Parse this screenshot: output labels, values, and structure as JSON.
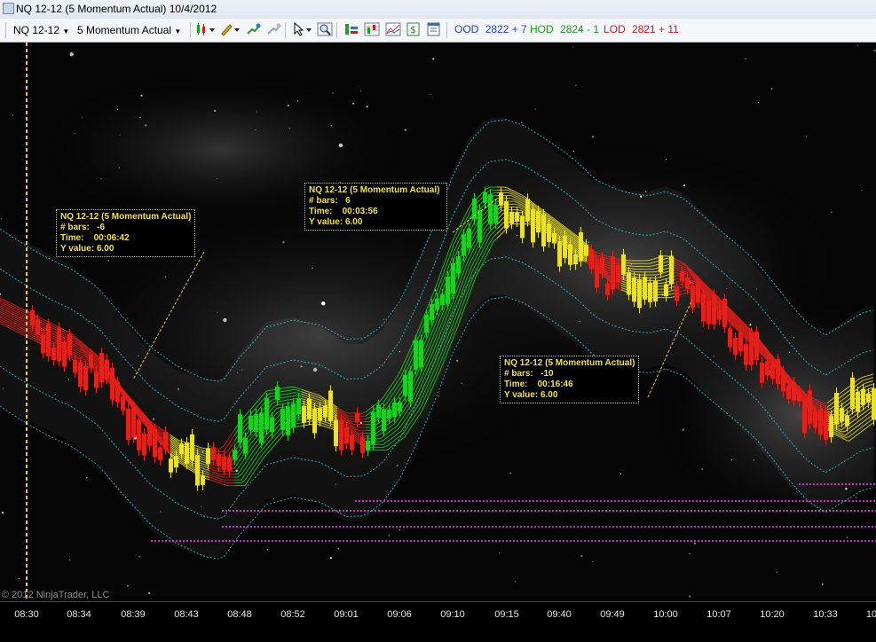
{
  "window": {
    "title": "NQ 12-12 (5 Momentum Actual)  10/4/2012"
  },
  "toolbar": {
    "instrument": "NQ 12-12",
    "period": "5 Momentum Actual",
    "icons": [
      "bar-type-icon",
      "draw-pencil-icon",
      "indicator-icon",
      "strategy-icon",
      "cursor-icon",
      "zoom-icon",
      "data-box-icon",
      "chart-style-icon",
      "dollar-icon",
      "properties-icon"
    ],
    "ood": {
      "label": "OOD",
      "value": "2822 + 7",
      "color": "#1f3fd0"
    },
    "hod": {
      "label": "HOD",
      "value": "2824 - 1",
      "color": "#1a9a1a"
    },
    "lod": {
      "label": "LOD",
      "value": "2821 + 11",
      "color": "#d31919"
    }
  },
  "callouts": [
    {
      "title": "NQ 12-12 (5 Momentum Actual)",
      "bars_label": "# bars:",
      "bars": "-6",
      "time_label": "Time:",
      "time": "00:06:42",
      "y_label": "Y value:",
      "y": "6.00"
    },
    {
      "title": "NQ 12-12 (5 Momentum Actual)",
      "bars_label": "# bars:",
      "bars": "6",
      "time_label": "Time:",
      "time": "00:03:56",
      "y_label": "Y value:",
      "y": "6.00"
    },
    {
      "title": "NQ 12-12 (5 Momentum Actual)",
      "bars_label": "# bars:",
      "bars": "-10",
      "time_label": "Time:",
      "time": "00:16:46",
      "y_label": "Y value:",
      "y": "6.00"
    }
  ],
  "time_axis": [
    "08:30",
    "08:34",
    "08:39",
    "08:43",
    "08:48",
    "08:52",
    "09:01",
    "09:06",
    "09:10",
    "09:15",
    "09:40",
    "09:49",
    "10:00",
    "10:07",
    "10:20",
    "10:33",
    "10"
  ],
  "copyright": "© 2012 NinjaTrader, LLC",
  "colors": {
    "up": "#19d11f",
    "down": "#e3211b",
    "neutral": "#e9e12a",
    "band": "#2bb8c8",
    "level": "#c925c9",
    "cursor": "#e8d21a"
  }
}
